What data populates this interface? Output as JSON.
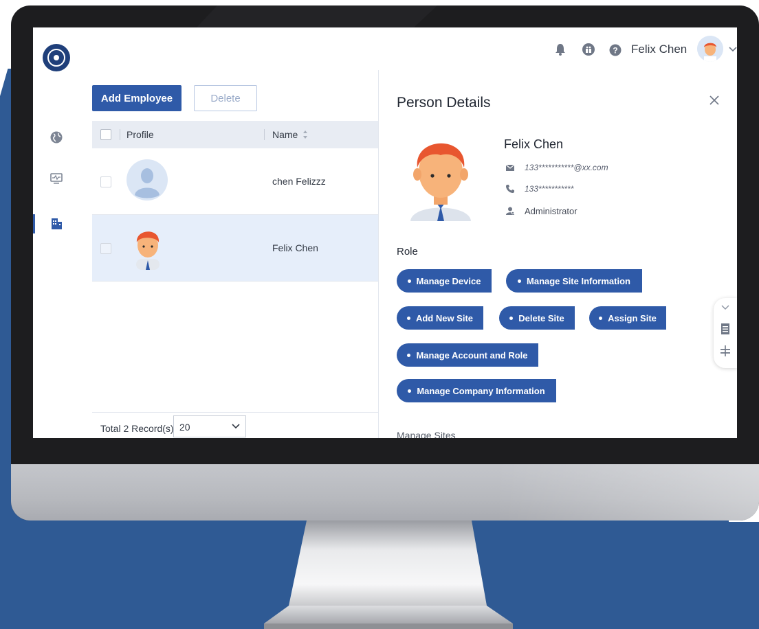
{
  "colors": {
    "primary": "#2f5aa8",
    "background_blue": "#2f5a94",
    "selected_row": "#e6eefa",
    "header_row": "#e8ecf3"
  },
  "header": {
    "user_name": "Felix Chen",
    "icons": [
      "bell-icon",
      "gift-icon",
      "help-icon",
      "avatar",
      "chevron-down-icon"
    ]
  },
  "sidebar": {
    "items": [
      {
        "icon": "globe-icon"
      },
      {
        "icon": "monitor-icon"
      },
      {
        "icon": "building-icon",
        "active": true
      }
    ]
  },
  "toolbar": {
    "add_label": "Add Employee",
    "delete_label": "Delete"
  },
  "table": {
    "columns": [
      "Profile",
      "Name"
    ],
    "rows": [
      {
        "name": "chen Felizzz",
        "avatar": "default-user-avatar"
      },
      {
        "name": "Felix Chen",
        "avatar": "cartoon-man-avatar",
        "selected": true
      }
    ],
    "total_label": "Total 2 Record(s)",
    "page_size": "20"
  },
  "details": {
    "title": "Person Details",
    "name": "Felix Chen",
    "email": "133***********@xx.com",
    "phone": "133***********",
    "role_name": "Administrator",
    "role_heading": "Role",
    "roles": [
      "Manage Device",
      "Manage Site Information",
      "Add New Site",
      "Delete Site",
      "Assign Site",
      "Manage Account and Role",
      "Manage Company Information"
    ],
    "next_section": "Manage Sites"
  }
}
